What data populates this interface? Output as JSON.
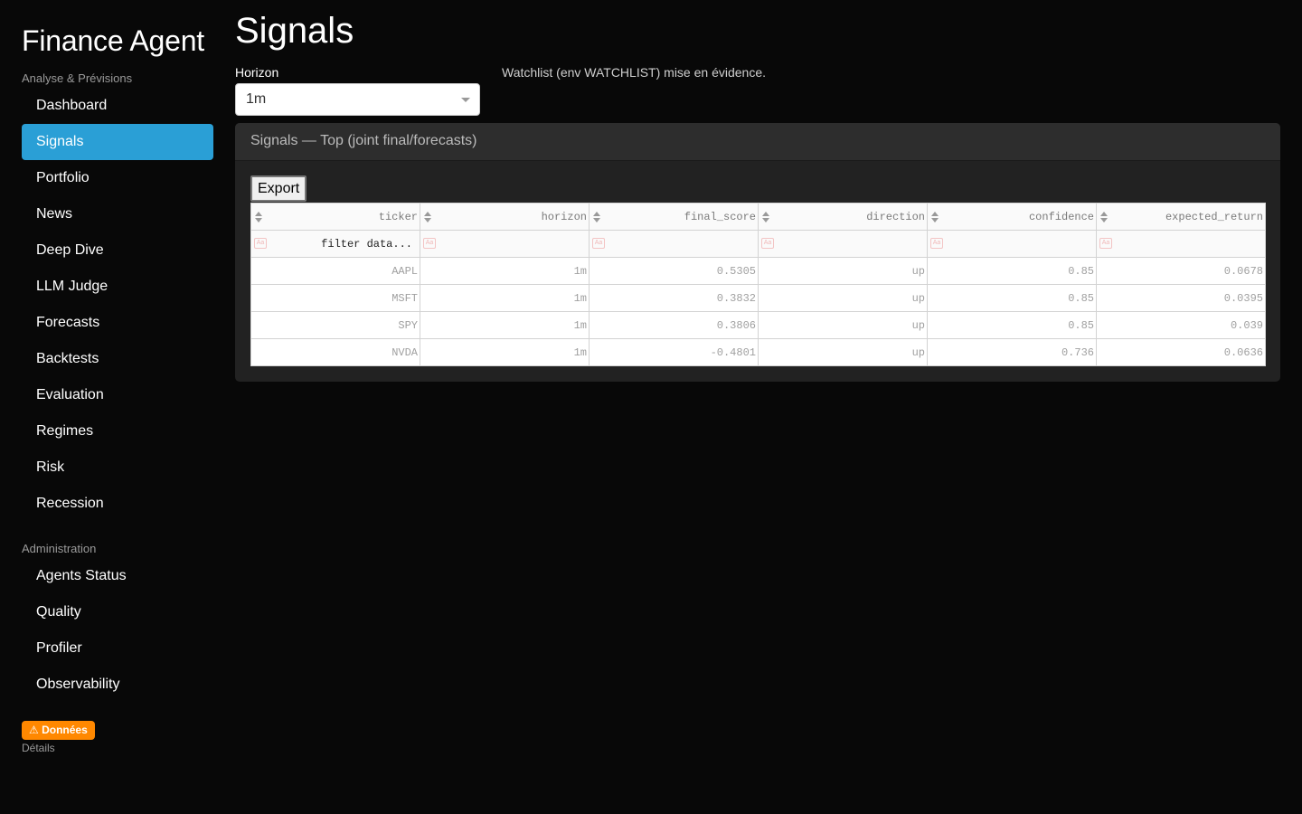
{
  "sidebar": {
    "brand": "Finance Agent",
    "section1_label": "Analyse & Prévisions",
    "section1_items": [
      {
        "label": "Dashboard",
        "active": false
      },
      {
        "label": "Signals",
        "active": true
      },
      {
        "label": "Portfolio",
        "active": false
      },
      {
        "label": "News",
        "active": false
      },
      {
        "label": "Deep Dive",
        "active": false
      },
      {
        "label": "LLM Judge",
        "active": false
      },
      {
        "label": "Forecasts",
        "active": false
      },
      {
        "label": "Backtests",
        "active": false
      },
      {
        "label": "Evaluation",
        "active": false
      },
      {
        "label": "Regimes",
        "active": false
      },
      {
        "label": "Risk",
        "active": false
      },
      {
        "label": "Recession",
        "active": false
      }
    ],
    "section2_label": "Administration",
    "section2_items": [
      {
        "label": "Agents Status"
      },
      {
        "label": "Quality"
      },
      {
        "label": "Profiler"
      },
      {
        "label": "Observability"
      }
    ],
    "badge": "⚠ Données",
    "details": "Détails"
  },
  "main": {
    "title": "Signals",
    "horizon_label": "Horizon",
    "horizon_value": "1m",
    "watchlist_note": "Watchlist (env WATCHLIST) mise en évidence.",
    "card_title": "Signals — Top (joint final/forecasts)",
    "export_label": "Export",
    "filter_placeholder": "filter data...",
    "filter_case_icon": "Aa",
    "columns": [
      "ticker",
      "horizon",
      "final_score",
      "direction",
      "confidence",
      "expected_return"
    ],
    "rows": [
      [
        "AAPL",
        "1m",
        "0.5305",
        "up",
        "0.85",
        "0.0678"
      ],
      [
        "MSFT",
        "1m",
        "0.3832",
        "up",
        "0.85",
        "0.0395"
      ],
      [
        "SPY",
        "1m",
        "0.3806",
        "up",
        "0.85",
        "0.039"
      ],
      [
        "NVDA",
        "1m",
        "-0.4801",
        "up",
        "0.736",
        "0.0636"
      ]
    ]
  },
  "colors": {
    "background": "#080808",
    "accent": "#2a9fd6",
    "warning": "#ff8800",
    "card": "#222222"
  }
}
